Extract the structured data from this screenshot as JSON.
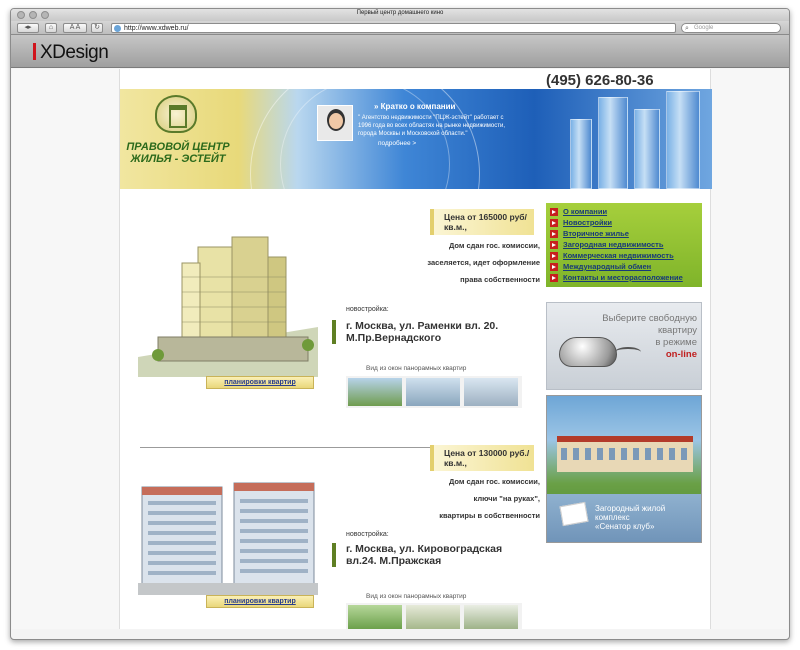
{
  "browser": {
    "window_title": "Первый центр домашнего кино",
    "url": "http://www.xdweb.ru/",
    "search_placeholder": "Google"
  },
  "brand_bar": {
    "logo_text": "XDesign"
  },
  "site": {
    "phone": "(495) 626-80-36",
    "company_name": "ПРАВОВОЙ ЦЕНТР ЖИЛЬЯ - ЭСТЕЙТ",
    "about_title": "» Кратко о компании",
    "about_text": "\" Агентство недвижимости \"ПЦЖ-эстейт\" работает с 1996 года во всех областях на рынке недвижимости, города Москвы и Московской области.\"",
    "about_more": "подробнее >"
  },
  "listings": [
    {
      "price": "Цена от 165000 руб/кв.м.,",
      "note_lines": [
        "Дом сдан  гос. комиссии,",
        "заселяется, идет оформление",
        "права собственности"
      ],
      "type_label": "новостройка:",
      "address": "г. Москва, ул. Раменки вл. 20. М.Пр.Вернадского",
      "panorama_label": "Вид из окон панорамных квартир",
      "plans_label": "планировки квартир"
    },
    {
      "price": "Цена от 130000 руб./кв.м.,",
      "note_lines": [
        "Дом сдан  гос. комиссии,",
        "ключи \"на руках\",",
        "квартиры в собственности"
      ],
      "type_label": "новостройка:",
      "address": "г. Москва, ул. Кировоградская вл.24. М.Пражская",
      "panorama_label": "Вид из окон панорамных квартир",
      "plans_label": "планировки квартир"
    }
  ],
  "menu": {
    "items": [
      {
        "label": "О компании"
      },
      {
        "label": "Новостройки"
      },
      {
        "label": "Вторичное жилье"
      },
      {
        "label": "Загородная недвижимость"
      },
      {
        "label": "Коммерческая недвижимость"
      },
      {
        "label": "Международный обмен"
      },
      {
        "label": "Контакты и месторасположение"
      }
    ]
  },
  "promos": {
    "online_line1": "Выберите свободную",
    "online_line2": "квартиру",
    "online_line3": "в режиме",
    "online_line4": "on-line",
    "country_line1": "Загородный жилой",
    "country_line2": "комплекс",
    "country_line3": "«Сенатор клуб»"
  },
  "colors": {
    "menu_green": "#8fc234",
    "arrow_red": "#c7201e",
    "link_blue": "#183a78",
    "price_yellow": "#f0e294"
  }
}
